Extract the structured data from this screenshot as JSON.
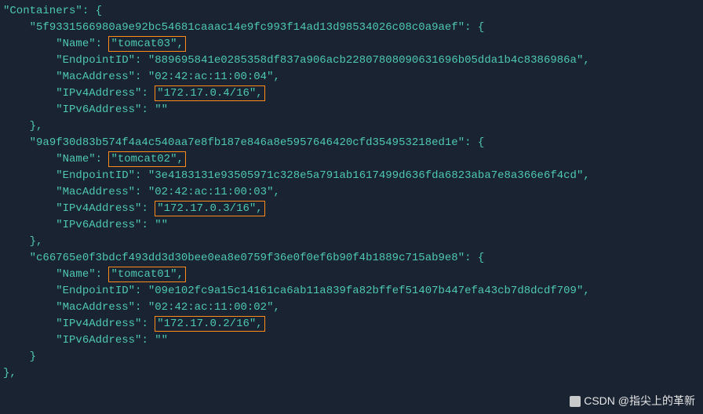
{
  "header": {
    "containers_key": "\"Containers\"",
    "open": ": {"
  },
  "containers": [
    {
      "id": "\"5f9331566980a9e92bc54681caaac14e9fc993f14ad13d98534026c08c0a9aef\"",
      "name_key": "\"Name\"",
      "name_val": "\"tomcat03\"",
      "endpoint_key": "\"EndpointID\"",
      "endpoint_val": "\"889695841e0285358df837a906acb22807808090631696b05dda1b4c8386986a\"",
      "mac_key": "\"MacAddress\"",
      "mac_val": "\"02:42:ac:11:00:04\"",
      "ipv4_key": "\"IPv4Address\"",
      "ipv4_val": "\"172.17.0.4/16\"",
      "ipv6_key": "\"IPv6Address\"",
      "ipv6_val": "\"\""
    },
    {
      "id": "\"9a9f30d83b574f4a4c540aa7e8fb187e846a8e5957646420cfd354953218ed1e\"",
      "name_key": "\"Name\"",
      "name_val": "\"tomcat02\"",
      "endpoint_key": "\"EndpointID\"",
      "endpoint_val": "\"3e4183131e93505971c328e5a791ab1617499d636fda6823aba7e8a366e6f4cd\"",
      "mac_key": "\"MacAddress\"",
      "mac_val": "\"02:42:ac:11:00:03\"",
      "ipv4_key": "\"IPv4Address\"",
      "ipv4_val": "\"172.17.0.3/16\"",
      "ipv6_key": "\"IPv6Address\"",
      "ipv6_val": "\"\""
    },
    {
      "id": "\"c66765e0f3bdcf493dd3d30bee0ea8e0759f36e0f0ef6b90f4b1889c715ab9e8\"",
      "name_key": "\"Name\"",
      "name_val": "\"tomcat01\"",
      "endpoint_key": "\"EndpointID\"",
      "endpoint_val": "\"09e102fc9a15c14161ca6ab11a839fa82bffef51407b447efa43cb7d8dcdf709\"",
      "mac_key": "\"MacAddress\"",
      "mac_val": "\"02:42:ac:11:00:02\"",
      "ipv4_key": "\"IPv4Address\"",
      "ipv4_val": "\"172.17.0.2/16\"",
      "ipv6_key": "\"IPv6Address\"",
      "ipv6_val": "\"\""
    }
  ],
  "closing": {
    "brace1": "    }",
    "brace2": "},"
  },
  "watermark": "@指尖上的革新",
  "watermark_prefix": "CSDN "
}
